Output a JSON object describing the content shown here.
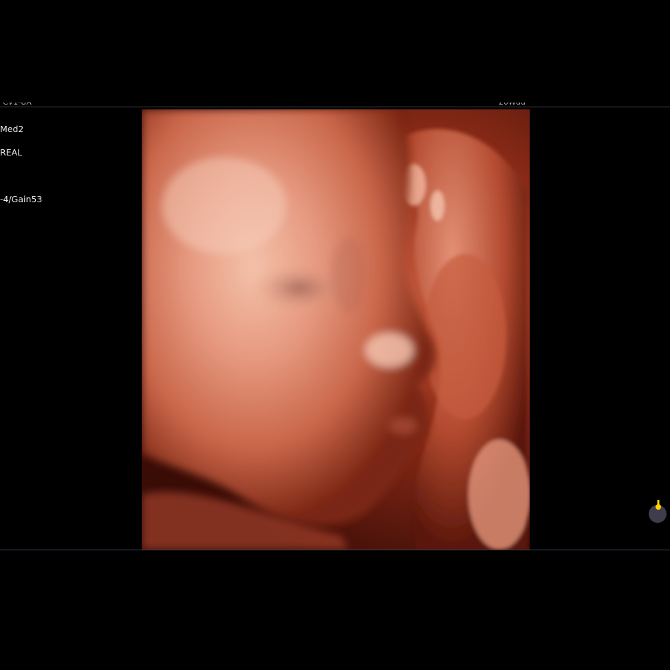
{
  "header": {
    "left_partial": "CV1-UA",
    "right_partial": "20Wdd"
  },
  "parameters": [
    "",
    "Med2",
    "",
    "REAL",
    "",
    "",
    "",
    "-4/Gain53"
  ],
  "render_view": {
    "mode": "3D surface render",
    "subject": "fetal face profile",
    "palette": [
      "#f3b29a",
      "#d9785e",
      "#b44630",
      "#6a1a0e",
      "#2a0805"
    ]
  },
  "indicator": {
    "icon": "orientation-marker-icon",
    "color": "#ffd400"
  }
}
